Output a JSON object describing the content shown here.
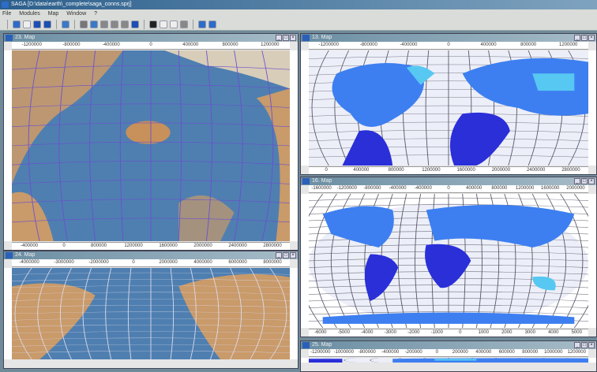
{
  "app": {
    "title": "SAGA [D:\\data\\earth\\_complete\\saga_conns.sprj]"
  },
  "menu": [
    "File",
    "Modules",
    "Map",
    "Window",
    "?"
  ],
  "toolbar": {
    "icons": [
      "open-project-icon",
      "new-icon",
      "save-icon",
      "info-icon",
      "help-icon",
      "zoom-icon",
      "pan-icon",
      "layers-icon",
      "copy-icon",
      "print-icon",
      "map-icon",
      "pointer-icon",
      "select-icon",
      "hand-icon",
      "measure-icon",
      "3d-view-icon",
      "layout-icon"
    ]
  },
  "colors": {
    "land": "#c99a6a",
    "ocean": "#4f7fb0",
    "country_dark": "#2a2fd8",
    "country_mid": "#3d7ff0",
    "country_light": "#56c8f2",
    "paper": "#eceef8"
  },
  "windows": {
    "w23": {
      "title": "23. Map",
      "top": [
        "-1200000",
        "-800000",
        "-400000",
        "0",
        "400000",
        "800000",
        "1200000"
      ],
      "bottom": [
        "-400000",
        "0",
        "800000",
        "1200000",
        "1600000",
        "2000000",
        "2400000",
        "2800000"
      ]
    },
    "w24": {
      "title": "24. Map",
      "top": [
        "-4000000",
        "-3000000",
        "-2000000",
        "0",
        "2000000",
        "4000000",
        "6000000",
        "8000000"
      ]
    },
    "w13": {
      "title": "13. Map",
      "top": [
        "-1200000",
        "-800000",
        "-400000",
        "0",
        "400000",
        "800000",
        "1200000"
      ],
      "bottom": [
        "0",
        "400000",
        "800000",
        "1200000",
        "1600000",
        "2000000",
        "2400000",
        "2800000"
      ]
    },
    "w16": {
      "title": "16. Map",
      "top": [
        "-1600000",
        "-1200000",
        "-800000",
        "-400000",
        "-400000",
        "0",
        "400000",
        "800000",
        "1200000",
        "1600000",
        "2000000"
      ],
      "bottom": [
        "-6000",
        "-5000",
        "-4000",
        "-3000",
        "-2000",
        "-1000",
        "0",
        "1000",
        "2000",
        "3000",
        "4000",
        "5000"
      ]
    },
    "w25": {
      "title": "25. Map",
      "top": [
        "-1200000",
        "-1000000",
        "-800000",
        "-400000",
        "-200000",
        "0",
        "200000",
        "400000",
        "600000",
        "800000",
        "1000000",
        "1200000"
      ]
    }
  }
}
